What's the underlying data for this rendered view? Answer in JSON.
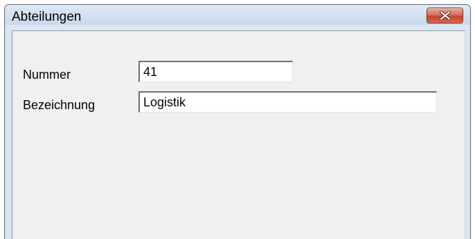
{
  "window": {
    "title": "Abteilungen",
    "close_icon": "close-x-icon"
  },
  "form": {
    "nummer_label": "Nummer",
    "nummer_value": "41",
    "bezeichnung_label": "Bezeichnung",
    "bezeichnung_value": "Logistik"
  },
  "colors": {
    "title_bar": "#d3e0f0",
    "client_background": "#f0f0f0",
    "close_button": "#c7432c"
  }
}
